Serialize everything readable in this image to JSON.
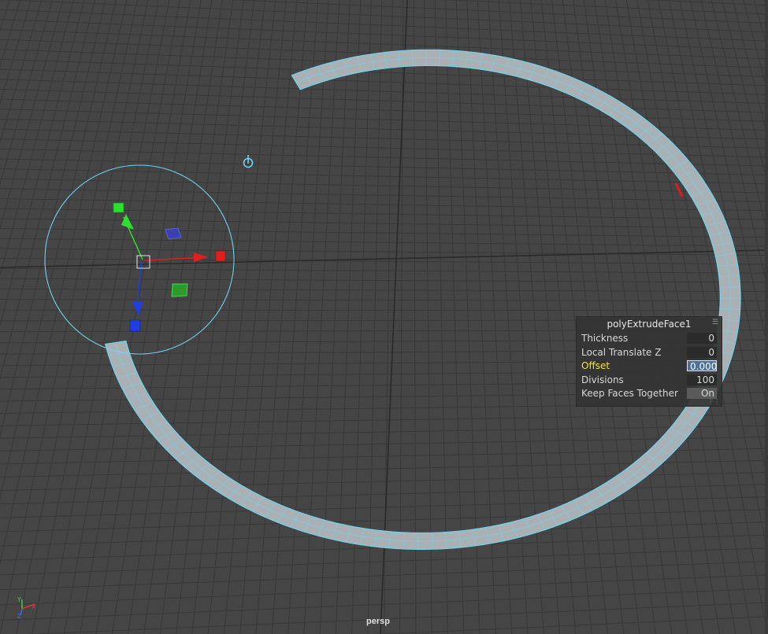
{
  "viewport": {
    "camera_label": "persp",
    "background_color": "#454545",
    "grid_color": "#383838",
    "axis_line_color": "#2a2a2a",
    "wireframe_color": "#6fd3ee",
    "mesh_color": "#a9b1b5"
  },
  "channel_box": {
    "title": "polyExtrudeFace1",
    "rows": [
      {
        "label": "Thickness",
        "value": "0",
        "state": "normal"
      },
      {
        "label": "Local Translate Z",
        "value": "0",
        "state": "normal"
      },
      {
        "label": "Offset",
        "value": "0.000",
        "state": "active"
      },
      {
        "label": "Divisions",
        "value": "100",
        "state": "normal"
      },
      {
        "label": "Keep Faces Together",
        "value": "On",
        "state": "toggle"
      }
    ],
    "active_label_color": "#f2e33c"
  },
  "axis_indicator": {
    "y_label": "Y",
    "x_label": "X",
    "z_label": "Z",
    "y_color": "#4fd14f",
    "x_color": "#e03a3a",
    "z_color": "#4a6bff"
  },
  "manipulator": {
    "x_color": "#e01e1e",
    "y_color": "#2ee02e",
    "z_color": "#1f3ee0"
  }
}
